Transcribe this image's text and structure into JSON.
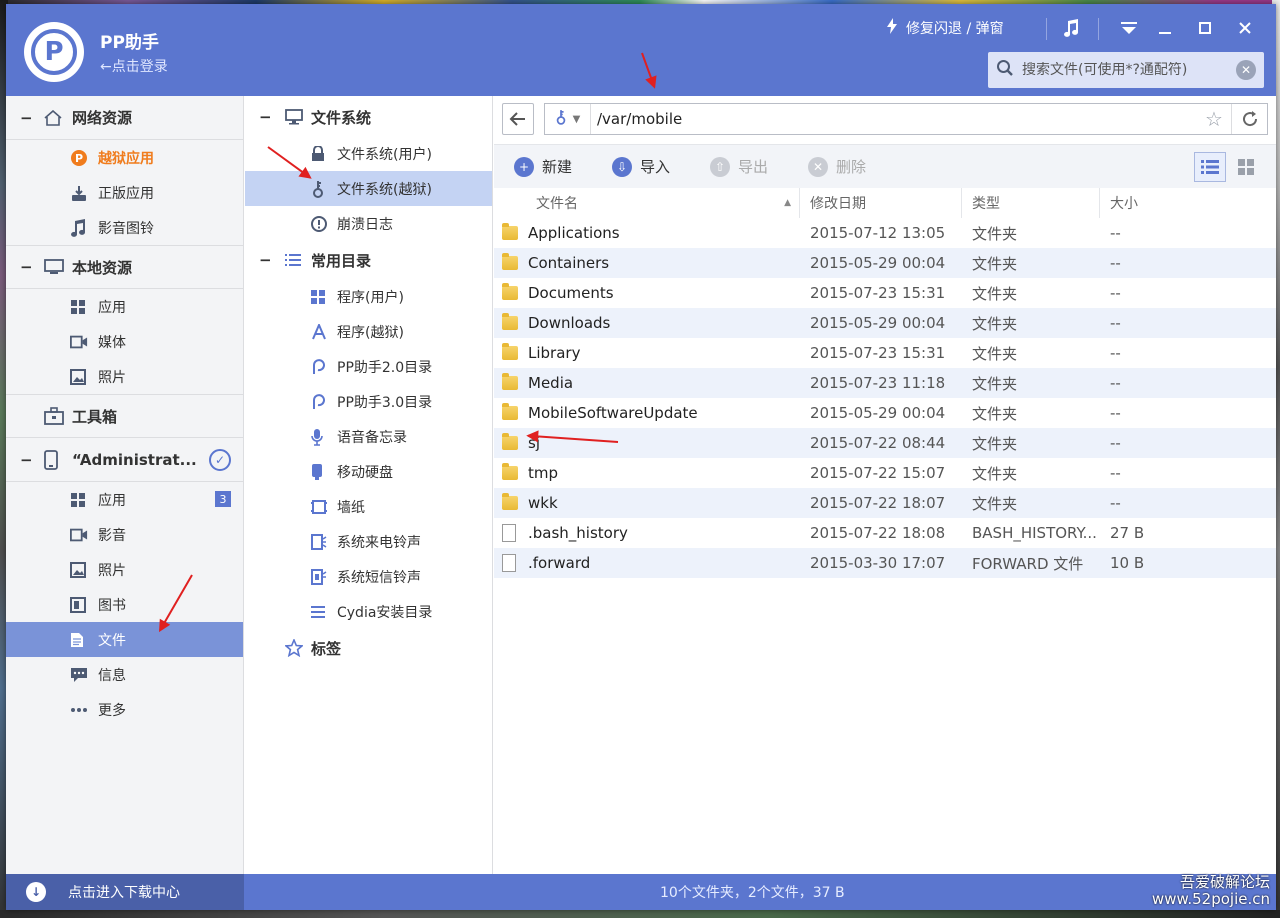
{
  "app": {
    "name": "PP助手",
    "login": "←点击登录",
    "repair": "修复闪退 / 弹窗",
    "search_placeholder": "搜索文件(可使用*?通配符)"
  },
  "leftnav": {
    "sections": [
      {
        "label": "网络资源",
        "items": [
          "越狱应用",
          "正版应用",
          "影音图铃"
        ]
      },
      {
        "label": "本地资源",
        "items": [
          "应用",
          "媒体",
          "照片"
        ]
      },
      {
        "label": "工具箱"
      },
      {
        "label": "“Administrat...",
        "items": [
          "应用",
          "影音",
          "照片",
          "图书",
          "文件",
          "信息",
          "更多"
        ],
        "badge": "3"
      }
    ]
  },
  "tree": {
    "fs_section": "文件系统",
    "fs_items": [
      "文件系统(用户)",
      "文件系统(越狱)",
      "崩溃日志"
    ],
    "common_section": "常用目录",
    "common_items": [
      "程序(用户)",
      "程序(越狱)",
      "PP助手2.0目录",
      "PP助手3.0目录",
      "语音备忘录",
      "移动硬盘",
      "墙纸",
      "系统来电铃声",
      "系统短信铃声",
      "Cydia安装目录"
    ],
    "tags": "标签"
  },
  "pane": {
    "path": "/var/mobile",
    "toolbar": {
      "new": "新建",
      "import": "导入",
      "export": "导出",
      "delete": "删除"
    },
    "columns": {
      "name": "文件名",
      "date": "修改日期",
      "type": "类型",
      "size": "大小"
    },
    "rows": [
      {
        "name": "Applications",
        "date": "2015-07-12 13:05",
        "type": "文件夹",
        "size": "--",
        "kind": "folder"
      },
      {
        "name": "Containers",
        "date": "2015-05-29 00:04",
        "type": "文件夹",
        "size": "--",
        "kind": "folder"
      },
      {
        "name": "Documents",
        "date": "2015-07-23 15:31",
        "type": "文件夹",
        "size": "--",
        "kind": "folder"
      },
      {
        "name": "Downloads",
        "date": "2015-05-29 00:04",
        "type": "文件夹",
        "size": "--",
        "kind": "folder"
      },
      {
        "name": "Library",
        "date": "2015-07-23 15:31",
        "type": "文件夹",
        "size": "--",
        "kind": "folder"
      },
      {
        "name": "Media",
        "date": "2015-07-23 11:18",
        "type": "文件夹",
        "size": "--",
        "kind": "folder"
      },
      {
        "name": "MobileSoftwareUpdate",
        "date": "2015-05-29 00:04",
        "type": "文件夹",
        "size": "--",
        "kind": "folder"
      },
      {
        "name": "sj",
        "date": "2015-07-22 08:44",
        "type": "文件夹",
        "size": "--",
        "kind": "folder"
      },
      {
        "name": "tmp",
        "date": "2015-07-22 15:07",
        "type": "文件夹",
        "size": "--",
        "kind": "folder"
      },
      {
        "name": "wkk",
        "date": "2015-07-22 18:07",
        "type": "文件夹",
        "size": "--",
        "kind": "folder"
      },
      {
        "name": ".bash_history",
        "date": "2015-07-22 18:08",
        "type": "BASH_HISTORY...",
        "size": "27 B",
        "kind": "file"
      },
      {
        "name": ".forward",
        "date": "2015-03-30 17:07",
        "type": "FORWARD 文件",
        "size": "10 B",
        "kind": "file"
      }
    ]
  },
  "status": {
    "download_center": "点击进入下载中心",
    "summary": "10个文件夹，2个文件，37 B",
    "watermark_line1": "吾爱破解论坛",
    "watermark_line2": "www.52pojie.cn"
  }
}
